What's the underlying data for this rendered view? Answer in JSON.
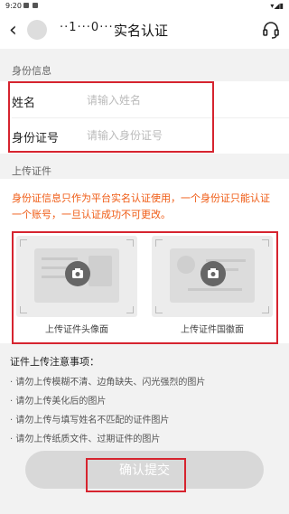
{
  "status_bar": {
    "time": "9:20"
  },
  "header": {
    "masked_number": "··1···0···",
    "title": "实名认证"
  },
  "identity_section": {
    "label": "身份信息",
    "name_label": "姓名",
    "name_placeholder": "请输入姓名",
    "id_label": "身份证号",
    "id_placeholder": "请输入身份证号"
  },
  "upload_section": {
    "label": "上传证件",
    "notice": "身份证信息只作为平台实名认证使用，一个身份证只能认证一个账号，一旦认证成功不可更改。",
    "front_caption": "上传证件头像面",
    "back_caption": "上传证件国徽面"
  },
  "rules": {
    "title": "证件上传注意事项：",
    "items": [
      "· 请勿上传模糊不清、边角缺失、闪光强烈的图片",
      "· 请勿上传美化后的图片",
      "· 请勿上传与填写姓名不匹配的证件图片",
      "· 请勿上传纸质文件、过期证件的图片"
    ]
  },
  "confirm_button": {
    "label": "确认提交"
  },
  "colors": {
    "notice": "#ef5a13",
    "highlight": "#d6242f",
    "button_disabled": "#d8d8d8"
  }
}
